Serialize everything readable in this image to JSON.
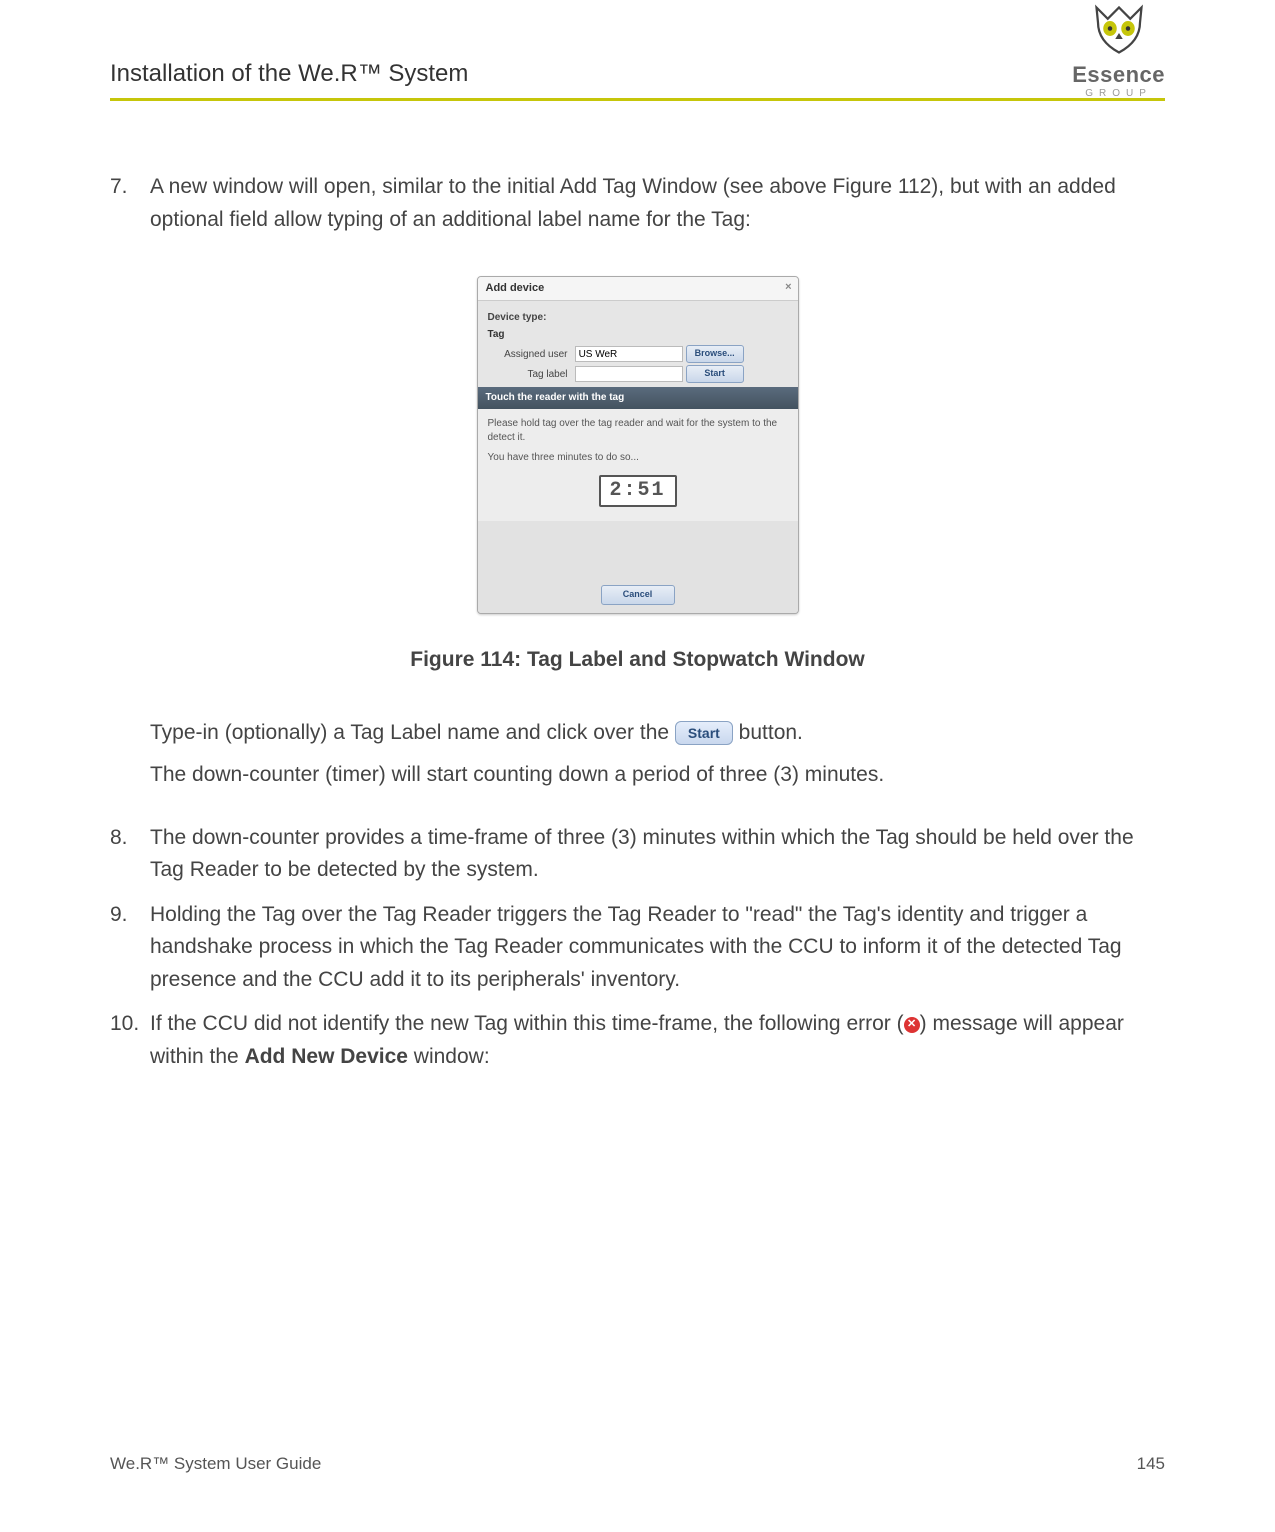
{
  "header": {
    "title": "Installation of the We.R™ System",
    "logo_main": "Essence",
    "logo_group": "GROUP"
  },
  "steps": {
    "s7": {
      "num": "7.",
      "text": "A new window will open, similar to the initial Add Tag Window (see above Figure 112), but with an added optional field allow typing of an additional label name for the Tag:"
    },
    "s7_sub1_pre": "Type-in (optionally) a Tag Label name and click over the ",
    "s7_sub1_btn": "Start",
    "s7_sub1_post": " button.",
    "s7_sub2": "The down-counter (timer) will start counting down a period of three (3) minutes.",
    "s8": {
      "num": "8.",
      "text": "The down-counter provides a time-frame of three (3) minutes within which the Tag should be held over the Tag Reader to be detected by the system."
    },
    "s9": {
      "num": "9.",
      "text": "Holding the Tag over the Tag Reader triggers the Tag Reader to \"read\" the Tag's identity and trigger a handshake process in which the Tag Reader communicates with the CCU to inform it of the detected Tag presence and the CCU add it to its peripherals' inventory."
    },
    "s10": {
      "num": "10.",
      "pre": "If the CCU did not identify the new Tag within this time-frame, the following error (",
      "post": ") message will appear within the ",
      "bold": "Add New Device",
      "tail": " window:"
    }
  },
  "figure": {
    "caption": "Figure 114: Tag Label and Stopwatch Window"
  },
  "dialog": {
    "title": "Add device",
    "close": "×",
    "device_type_label": "Device type:",
    "device_type_value": "Tag",
    "assigned_user_label": "Assigned user",
    "assigned_user_value": "US WeR",
    "browse_btn": "Browse...",
    "tag_label_label": "Tag label",
    "tag_label_value": "",
    "start_btn": "Start",
    "instruct_bar": "Touch the reader with the tag",
    "instruct_line1": "Please hold tag over the tag reader and wait for the system to the detect it.",
    "instruct_line2": "You have three minutes to do so...",
    "timer": "2:51",
    "cancel_btn": "Cancel"
  },
  "footer": {
    "left": "We.R™ System User Guide",
    "right": "145"
  }
}
